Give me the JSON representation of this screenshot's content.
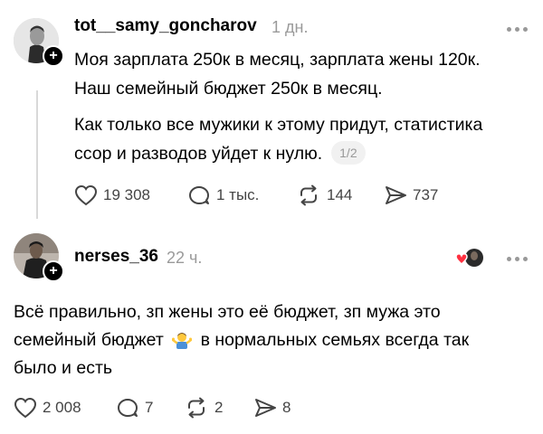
{
  "post1": {
    "username": "tot__samy_goncharov",
    "time": "1 дн.",
    "paragraph1": [
      "Моя зарплата 250к в месяц, зарплата жены 120к.",
      "Наш семейный бюджет 250к в месяц."
    ],
    "paragraph2": [
      "Как только все мужики к этому придут, статистика",
      "ссор и разводов уйдет к нулю."
    ],
    "pager": "1/2",
    "likes": "19 308",
    "comments": "1 тыс.",
    "reposts": "144",
    "shares": "737"
  },
  "post2": {
    "username": "nerses_36",
    "time": "22 ч.",
    "lines": [
      "Всё правильно, зп жены это её бюджет, зп мужа это",
      "семейный бюджет",
      "в нормальных семьях всегда так",
      "было и есть"
    ],
    "emoji": "man-shrugging-emoji",
    "likes": "2 008",
    "comments": "7",
    "reposts": "2",
    "shares": "8"
  },
  "icons": [
    "follow-plus-icon",
    "more-icon",
    "heart-icon",
    "comment-icon",
    "repost-icon",
    "share-icon"
  ],
  "colors": {
    "text": "#000000",
    "muted": "#9a9a9a",
    "thread_line": "#d9d9d9",
    "like_red": "#ff3040"
  }
}
